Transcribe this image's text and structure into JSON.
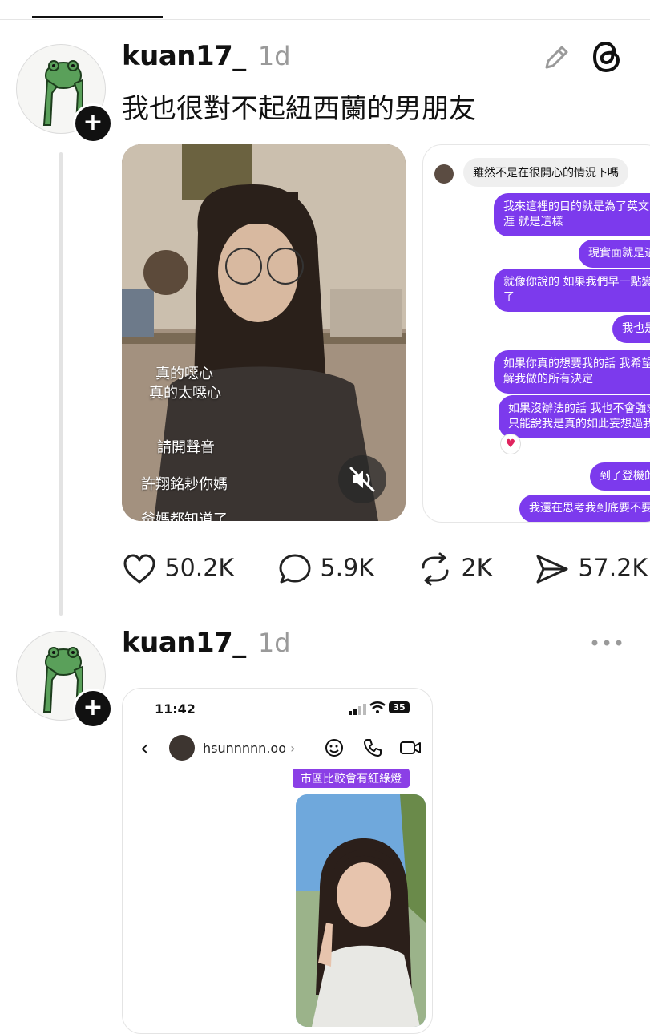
{
  "post1": {
    "username": "kuan17_",
    "time": "1d",
    "text": "我也很對不起紐西蘭的男朋友",
    "video_captions": [
      "真的噁心",
      "真的太噁心",
      "請開聲音",
      "許翔銘耖你媽",
      "爸媽都知道了"
    ],
    "dm_incoming": "雖然不是在很開心的情況下嗎",
    "dm_outgoing": [
      "我來這裡的目的就是為了英文",
      "涯 就是這樣",
      "現實面就是這",
      "就像你說的 如果我們早一點變",
      "了",
      "我也是",
      "如果你真的想要我的話 我希望",
      "解我做的所有決定",
      "如果沒辦法的話 我也不會強求",
      "只能說我是真的如此妄想過我",
      "到了登機的",
      "我還在思考我到底要不要"
    ],
    "actions": {
      "likes": "50.2K",
      "replies": "5.9K",
      "reposts": "2K",
      "shares": "57.2K"
    }
  },
  "post2": {
    "username": "kuan17_",
    "time": "1d",
    "screenshot": {
      "clock": "11:42",
      "battery": "35",
      "contact": "hsunnnnn.oo",
      "message": "市區比較會有紅綠燈"
    }
  },
  "icons": {
    "edit": "pencil-icon",
    "threads": "threads-logo-icon",
    "more": "more-dots-icon",
    "like": "heart-icon",
    "reply": "comment-icon",
    "repost": "repost-icon",
    "share": "send-icon"
  },
  "colors": {
    "accent_purple": "#7c3aed",
    "text": "#111111",
    "muted": "#9a9a9a"
  }
}
